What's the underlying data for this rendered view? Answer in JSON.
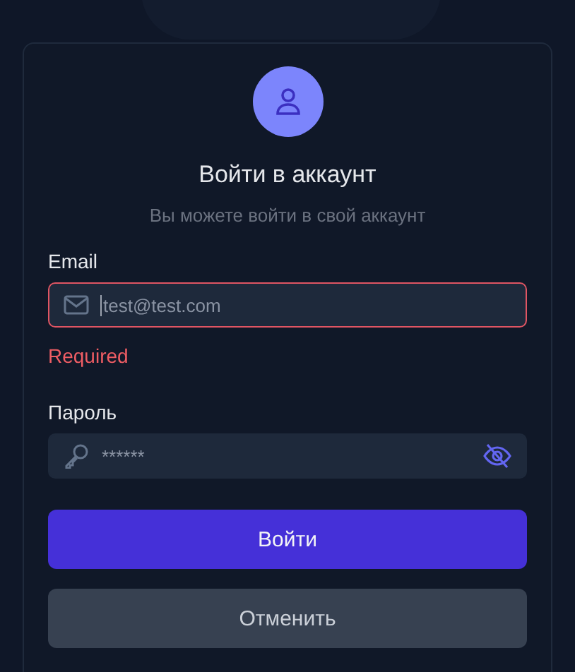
{
  "title": "Войти в аккаунт",
  "subtitle": "Вы можете войти в свой аккаунт",
  "fields": [
    {
      "kind": "email",
      "label": "Email",
      "placeholder": "test@test.com",
      "invalid": true,
      "focused": true,
      "error": "Required"
    },
    {
      "kind": "password",
      "label": "Пароль",
      "placeholder": "******",
      "invalid": false,
      "focused": false,
      "revealed": false
    }
  ],
  "buttons": [
    {
      "kind": "primary",
      "label": "Войти"
    },
    {
      "kind": "secondary",
      "label": "Отменить"
    }
  ]
}
